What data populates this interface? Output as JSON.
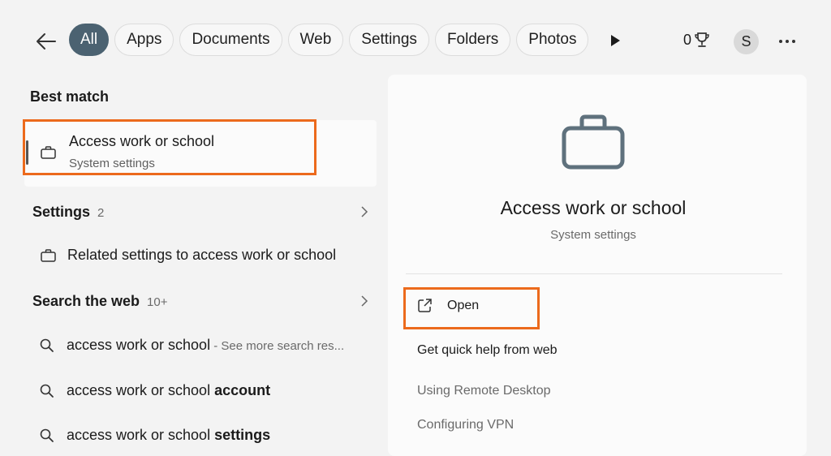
{
  "header": {
    "tabs": [
      {
        "label": "All",
        "active": true
      },
      {
        "label": "Apps",
        "active": false
      },
      {
        "label": "Documents",
        "active": false
      },
      {
        "label": "Web",
        "active": false
      },
      {
        "label": "Settings",
        "active": false
      },
      {
        "label": "Folders",
        "active": false
      },
      {
        "label": "Photos",
        "active": false
      }
    ],
    "points": "0",
    "avatar_initial": "S"
  },
  "left": {
    "best_match_title": "Best match",
    "best_match": {
      "title": "Access work or school",
      "subtitle": "System settings"
    },
    "settings_section": {
      "title": "Settings",
      "count": "2"
    },
    "settings_item": "Related settings to access work or school",
    "web_section": {
      "title": "Search the web",
      "count": "10+"
    },
    "web_results": [
      {
        "prefix": "access work or school",
        "bold": "",
        "suffix": " - See more search res..."
      },
      {
        "prefix": "access work or school ",
        "bold": "account",
        "suffix": ""
      },
      {
        "prefix": "access work or school ",
        "bold": "settings",
        "suffix": ""
      }
    ]
  },
  "right": {
    "title": "Access work or school",
    "subtitle": "System settings",
    "open_label": "Open",
    "links": [
      "Get quick help from web",
      "Using Remote Desktop",
      "Configuring VPN"
    ]
  },
  "colors": {
    "accent": "#4b6271",
    "highlight": "#ec6a1c",
    "panel": "#fbfbfb",
    "background": "#f3f3f3"
  },
  "icons": {
    "back": "arrow-left-icon",
    "play": "play-icon",
    "trophy": "trophy-icon",
    "more": "ellipsis-icon",
    "briefcase": "briefcase-icon",
    "search": "search-icon",
    "chevron": "chevron-right-icon",
    "open": "open-external-icon"
  }
}
